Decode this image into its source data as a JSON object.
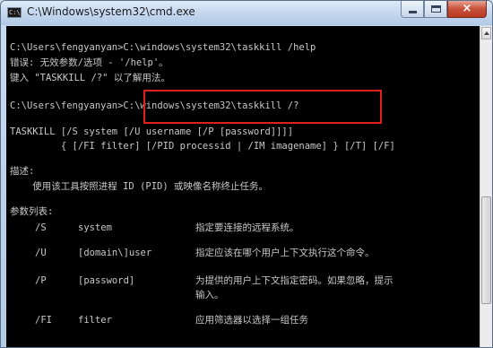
{
  "window": {
    "title": "C:\\Windows\\system32\\cmd.exe",
    "icon_label": "C:\\"
  },
  "controls": {
    "minimize": "minimize-icon",
    "maximize": "maximize-icon",
    "close": "×"
  },
  "console": {
    "line1": "C:\\Users\\fengyanyan>C:\\windows\\system32\\taskkill /help",
    "line2": "错误: 无效参数/选项 - '/help'。",
    "line3": "键入 \"TASKKILL /?\" 以了解用法。",
    "line4": "C:\\Users\\fengyanyan>C:\\windows\\system32\\taskkill /?",
    "line5": "TASKKILL [/S system [/U username [/P [password]]]]",
    "line6": "         { [/FI filter] [/PID processid | /IM imagename] } [/T] [/F]",
    "line7": "描述:",
    "line8": "    使用该工具按照进程 ID (PID) 或映像名称终止任务。",
    "line9": "参数列表:",
    "params": [
      {
        "switch": "/S",
        "arg": "system",
        "desc": "指定要连接的远程系统。"
      },
      {
        "switch": "/U",
        "arg": "[domain\\]user",
        "desc": "指定应该在哪个用户上下文执行这个命令。"
      },
      {
        "switch": "/P",
        "arg": "[password]",
        "desc": "为提供的用户上下文指定密码。如果忽略，提示",
        "desc2": "输入。"
      },
      {
        "switch": "/FI",
        "arg": "filter",
        "desc": "应用筛选器以选择一组任务"
      }
    ]
  },
  "colors": {
    "console_bg": "#000000",
    "console_text": "#c8c8c8",
    "highlight": "#e0201c"
  }
}
